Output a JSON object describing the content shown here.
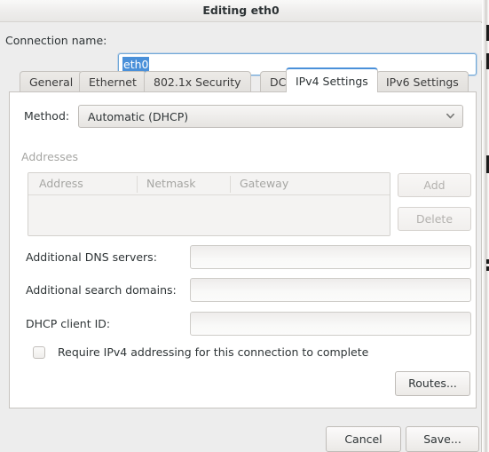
{
  "window": {
    "title": "Editing eth0"
  },
  "connection": {
    "label": "Connection name:",
    "value": "eth0",
    "selected": true,
    "focus_color": "#4a90d9",
    "selection_color": "#4a90d9"
  },
  "tabs": {
    "active_index": 4,
    "accent_color": "#4a90d9",
    "items": [
      {
        "label": "General",
        "active": false
      },
      {
        "label": "Ethernet",
        "active": false
      },
      {
        "label": "802.1x Security",
        "active": false
      },
      {
        "label": "DCB",
        "active": false
      },
      {
        "label": "IPv4 Settings",
        "active": true
      },
      {
        "label": "IPv6 Settings",
        "active": false
      }
    ]
  },
  "ipv4": {
    "method": {
      "label": "Method:",
      "value": "Automatic (DHCP)",
      "chevron_icon": "chevron-down-icon"
    },
    "addresses": {
      "section_label": "Addresses",
      "disabled": true,
      "columns": [
        "Address",
        "Netmask",
        "Gateway"
      ],
      "rows": [],
      "add_button": "Add",
      "delete_button": "Delete"
    },
    "fields": [
      {
        "label": "Additional DNS servers:",
        "value": "",
        "placeholder": ""
      },
      {
        "label": "Additional search domains:",
        "value": "",
        "placeholder": ""
      },
      {
        "label": "DHCP client ID:",
        "value": "",
        "placeholder": ""
      }
    ],
    "require_ipv4": {
      "label": "Require IPv4 addressing for this connection to complete",
      "checked": false
    },
    "routes_button": "Routes..."
  },
  "actions": {
    "cancel_label": "Cancel",
    "save_label": "Save..."
  }
}
